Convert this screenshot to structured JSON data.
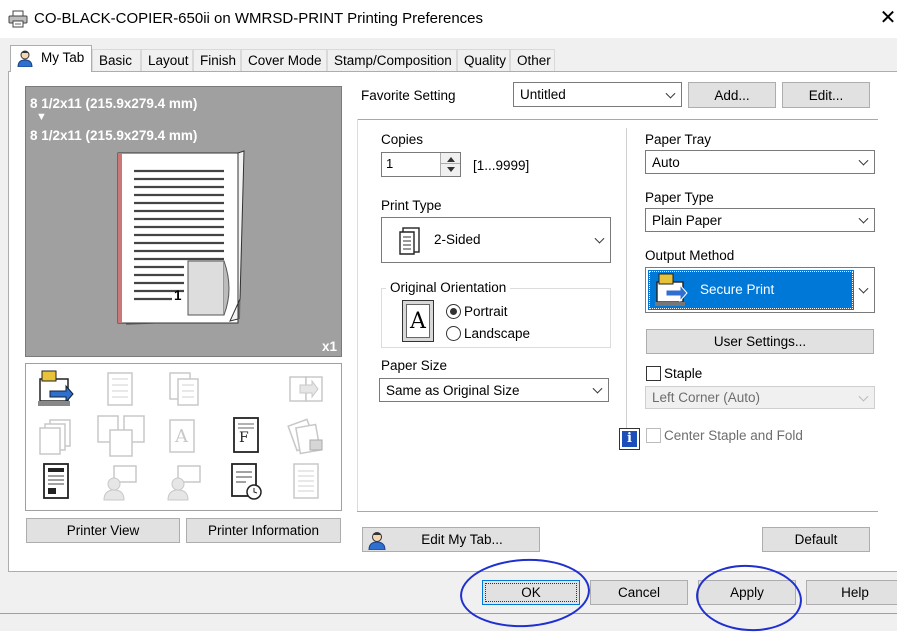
{
  "window": {
    "title": "CO-BLACK-COPIER-650ii on WMRSD-PRINT Printing Preferences",
    "close_glyph": "✕"
  },
  "tabs": [
    {
      "label": "My Tab",
      "active": true
    },
    {
      "label": "Basic"
    },
    {
      "label": "Layout"
    },
    {
      "label": "Finish"
    },
    {
      "label": "Cover Mode"
    },
    {
      "label": "Stamp/Composition"
    },
    {
      "label": "Quality"
    },
    {
      "label": "Other"
    }
  ],
  "preview": {
    "original_size": "8 1/2x11 (215.9x279.4 mm)",
    "arrow": "▼",
    "output_size": "8 1/2x11 (215.9x279.4 mm)",
    "page_number": "1",
    "copies_badge": "x1"
  },
  "left_buttons": {
    "printer_view": "Printer View",
    "printer_information": "Printer Information"
  },
  "favorite": {
    "label": "Favorite Setting",
    "value": "Untitled",
    "add": "Add...",
    "edit": "Edit..."
  },
  "copies": {
    "label": "Copies",
    "value": "1",
    "range": "[1...9999]"
  },
  "print_type": {
    "label": "Print Type",
    "value": "2-Sided"
  },
  "orientation": {
    "label": "Original Orientation",
    "icon_letter": "A",
    "portrait": "Portrait",
    "landscape": "Landscape",
    "selected": "Portrait"
  },
  "paper_size": {
    "label": "Paper Size",
    "value": "Same as Original Size"
  },
  "paper_tray": {
    "label": "Paper Tray",
    "value": "Auto"
  },
  "paper_type": {
    "label": "Paper Type",
    "value": "Plain Paper"
  },
  "output_method": {
    "label": "Output Method",
    "value": "Secure Print"
  },
  "user_settings": "User Settings...",
  "staple": {
    "label": "Staple",
    "position": "Left Corner (Auto)",
    "checked": false
  },
  "center_staple": {
    "label": "Center Staple and Fold",
    "checked": false
  },
  "info_glyph": "i",
  "edit_my_tab": "Edit My Tab...",
  "default": "Default",
  "footer": {
    "ok": "OK",
    "cancel": "Cancel",
    "apply": "Apply",
    "help": "Help"
  },
  "colors": {
    "selection_blue": "#0078d7",
    "annotation_blue": "#1f2fd0",
    "preview_gray": "#a0a0a0"
  }
}
